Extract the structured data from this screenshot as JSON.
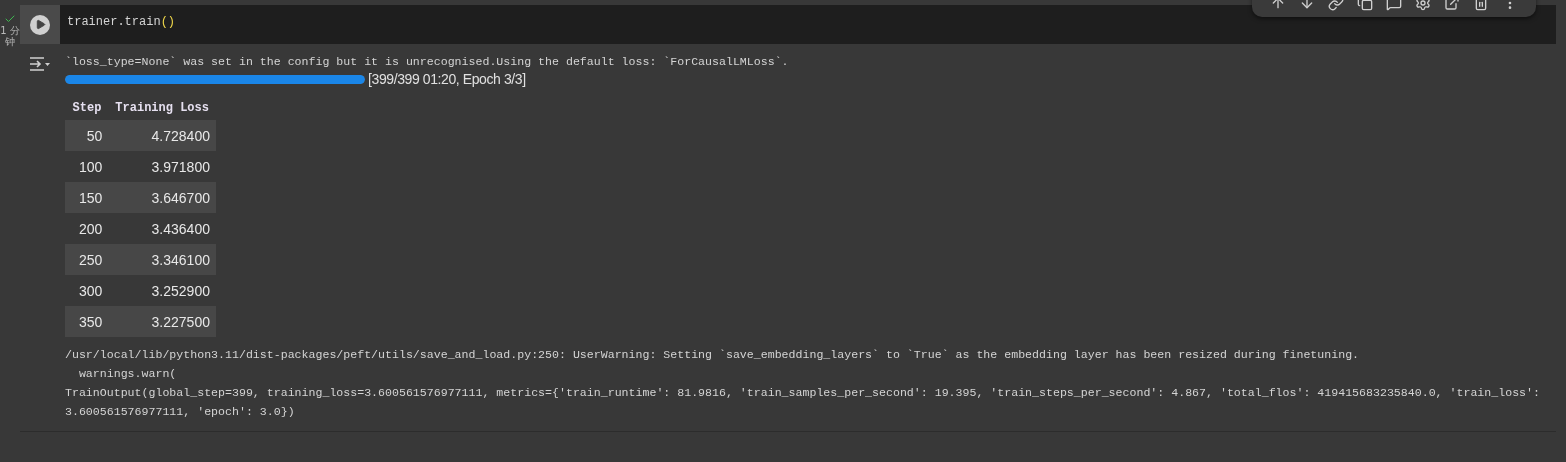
{
  "cell": {
    "done": true,
    "elapsed": "1 分钟",
    "code": [
      {
        "text": "trainer.train",
        "kind": "plain"
      },
      {
        "text": "()",
        "kind": "bracket"
      }
    ],
    "output": {
      "message": "`loss_type=None` was set in the config but it is unrecognised.Using the default loss: `ForCausalLMLoss`.",
      "progress": {
        "level": 1,
        "label": "[399/399 01:20, Epoch 3/3]"
      },
      "table": {
        "columns": [
          "Step",
          "Training Loss"
        ],
        "rows": [
          [
            "50",
            "4.728400"
          ],
          [
            "100",
            "3.971800"
          ],
          [
            "150",
            "3.646700"
          ],
          [
            "200",
            "3.436400"
          ],
          [
            "250",
            "3.346100"
          ],
          [
            "300",
            "3.252900"
          ],
          [
            "350",
            "3.227500"
          ]
        ]
      },
      "lines": [
        "/usr/local/lib/python3.11/dist-packages/peft/utils/save_and_load.py:250: UserWarning: Setting `save_embedding_layers` to `True` as the embedding layer has been resized during finetuning.",
        "  warnings.warn(",
        "TrainOutput(global_step=399, training_loss=3.600561576977111, metrics={'train_runtime': 81.9816, 'train_samples_per_second': 19.395, 'train_steps_per_second': 4.867, 'total_flos': 419415683235840.0, 'train_loss':",
        "3.600561576977111, 'epoch': 3.0})"
      ]
    }
  }
}
